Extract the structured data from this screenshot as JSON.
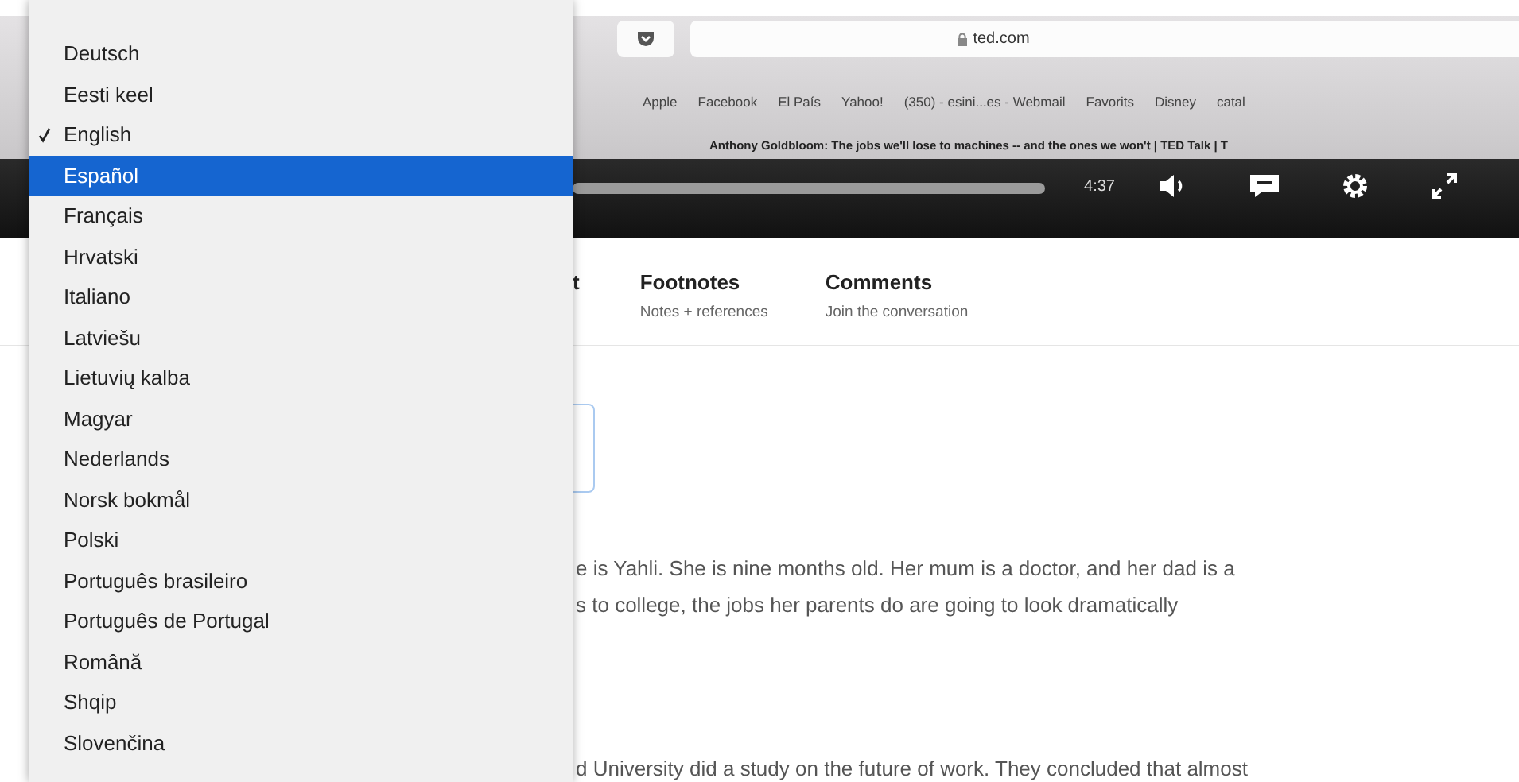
{
  "browser": {
    "url": "ted.com",
    "bookmarks": [
      "Apple",
      "Facebook",
      "El País",
      "Yahoo!",
      "(350) - esini...es - Webmail",
      "Favorits",
      "Disney",
      "catal"
    ],
    "page_title": "Anthony Goldbloom: The jobs we'll lose to machines -- and the ones we won't | TED Talk | T"
  },
  "video": {
    "time": "4:37"
  },
  "tabs": [
    {
      "title": "t"
    },
    {
      "title": "Footnotes",
      "subtitle": "Notes + references"
    },
    {
      "title": "Comments",
      "subtitle": "Join the conversation"
    }
  ],
  "paragraphs": [
    "e is Yahli. She is nine months old. Her mum is a doctor, and her dad is a",
    "s to college, the jobs her parents do are going to look dramatically",
    "d University did a study on the future of work. They concluded that almost"
  ],
  "language_menu": [
    {
      "label": "Deutsch",
      "checked": false,
      "selected": false
    },
    {
      "label": "Eesti keel",
      "checked": false,
      "selected": false
    },
    {
      "label": "English",
      "checked": true,
      "selected": false
    },
    {
      "label": "Español",
      "checked": false,
      "selected": true
    },
    {
      "label": "Français",
      "checked": false,
      "selected": false
    },
    {
      "label": "Hrvatski",
      "checked": false,
      "selected": false
    },
    {
      "label": "Italiano",
      "checked": false,
      "selected": false
    },
    {
      "label": "Latviešu",
      "checked": false,
      "selected": false
    },
    {
      "label": "Lietuvių kalba",
      "checked": false,
      "selected": false
    },
    {
      "label": "Magyar",
      "checked": false,
      "selected": false
    },
    {
      "label": "Nederlands",
      "checked": false,
      "selected": false
    },
    {
      "label": "Norsk bokmål",
      "checked": false,
      "selected": false
    },
    {
      "label": "Polski",
      "checked": false,
      "selected": false
    },
    {
      "label": "Português brasileiro",
      "checked": false,
      "selected": false
    },
    {
      "label": "Português de Portugal",
      "checked": false,
      "selected": false
    },
    {
      "label": "Română",
      "checked": false,
      "selected": false
    },
    {
      "label": "Shqip",
      "checked": false,
      "selected": false
    },
    {
      "label": "Slovenčina",
      "checked": false,
      "selected": false
    }
  ]
}
